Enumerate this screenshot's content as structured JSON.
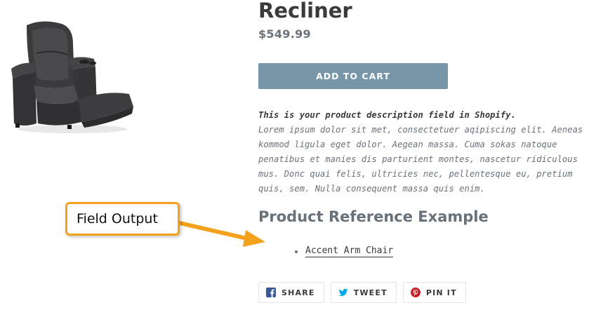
{
  "product": {
    "title": "Recliner",
    "price": "$549.99",
    "add_to_cart_label": "Add to cart",
    "description_lead": "This is your product description field in Shopify.",
    "description_body": "Lorem ipsum dolor sit met, consectetuer aqipiscing elit. Aeneas kommod ligula eget dolor. Aegean massa. Cuma sokas natoque penatibus et manies dis parturient montes, nascetur ridiculous mus. Donc quai felis, ultricies nec, pellentesque eu, pretium quis, sem. Nulla consequent massa quis enim.",
    "image_icon": "recliner-chair-image"
  },
  "reference": {
    "heading": "Product Reference Example",
    "items": [
      {
        "label": "Accent Arm Chair"
      }
    ]
  },
  "share": {
    "buttons": [
      {
        "label": "Share",
        "icon": "facebook-icon"
      },
      {
        "label": "Tweet",
        "icon": "twitter-icon"
      },
      {
        "label": "Pin it",
        "icon": "pinterest-icon"
      }
    ]
  },
  "annotation": {
    "callout_label": "Field Output",
    "color": "#f4a11d"
  },
  "colors": {
    "button": "#7796a8",
    "text": "#3a3a3a",
    "muted": "#69727b",
    "facebook": "#3b5998",
    "twitter": "#00aced",
    "pinterest": "#cb2027"
  }
}
